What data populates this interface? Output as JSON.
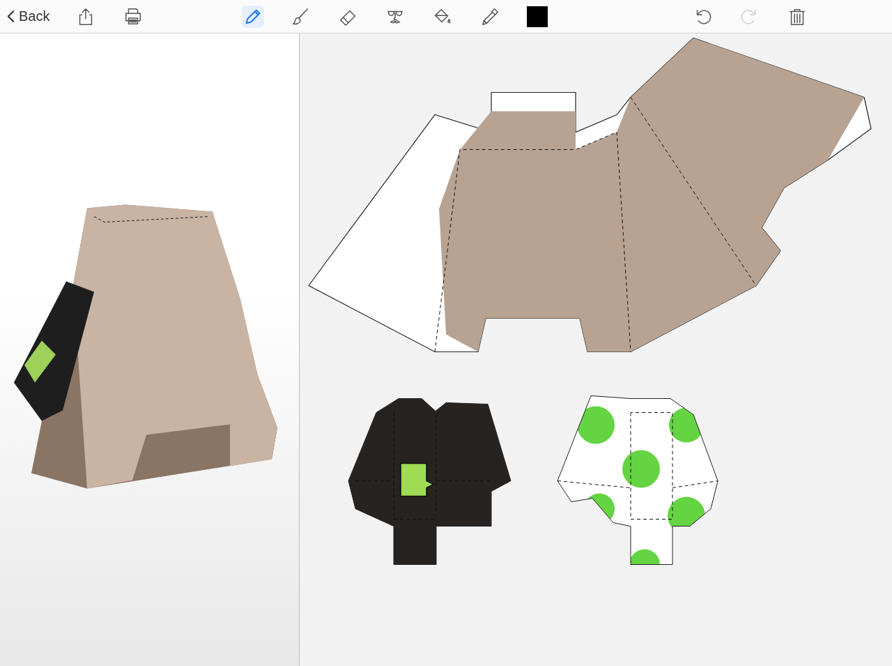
{
  "toolbar": {
    "back": {
      "label": "Back"
    },
    "left_actions": [
      {
        "kind": "share"
      },
      {
        "kind": "print"
      }
    ],
    "tools": [
      {
        "kind": "pencil",
        "selected": true
      },
      {
        "kind": "brush",
        "selected": false
      },
      {
        "kind": "eraser",
        "selected": false
      },
      {
        "kind": "mask",
        "selected": false
      },
      {
        "kind": "bucket",
        "selected": false
      },
      {
        "kind": "eyedropper",
        "selected": false
      },
      {
        "kind": "swatch",
        "selected": false,
        "color": "#000000"
      }
    ],
    "right_actions": [
      {
        "kind": "undo",
        "disabled": false
      },
      {
        "kind": "redo",
        "disabled": true
      },
      {
        "kind": "trash",
        "disabled": false
      }
    ]
  },
  "preview": {
    "kind": "model"
  },
  "canvas": {
    "pieces": [
      {
        "kind": "head"
      },
      {
        "kind": "torso-print"
      },
      {
        "kind": "torso-dots"
      }
    ]
  }
}
